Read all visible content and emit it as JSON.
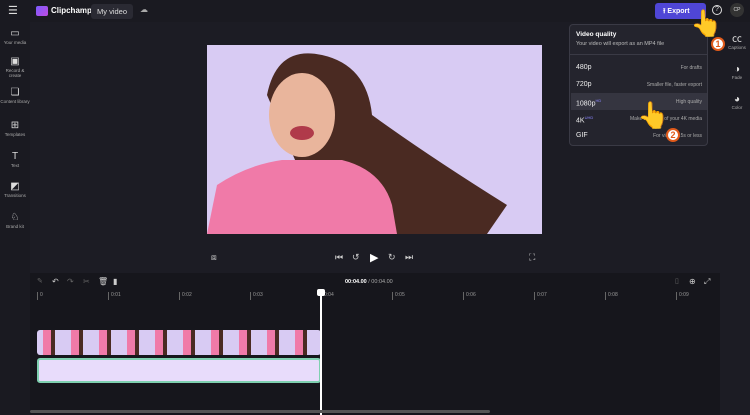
{
  "header": {
    "app_name": "Clipchamp",
    "project_name": "My video",
    "export_label": "Export",
    "avatar": "CP"
  },
  "sidebar": {
    "items": [
      {
        "label": "Your media",
        "icon": "folder-icon"
      },
      {
        "label": "Record & create",
        "icon": "camera-icon"
      },
      {
        "label": "Content library",
        "icon": "library-icon"
      },
      {
        "label": "Templates",
        "icon": "templates-icon"
      },
      {
        "label": "Text",
        "icon": "text-icon"
      },
      {
        "label": "Transitions",
        "icon": "transitions-icon"
      },
      {
        "label": "Brand kit",
        "icon": "brand-kit-icon"
      }
    ]
  },
  "right_panel": {
    "items": [
      {
        "label": "Captions"
      },
      {
        "label": "Fade"
      },
      {
        "label": "Color"
      }
    ]
  },
  "export_menu": {
    "title": "Video quality",
    "subtitle": "Your video will export as an MP4 file",
    "options": [
      {
        "label": "480p",
        "badge": "",
        "desc": "For drafts"
      },
      {
        "label": "720p",
        "badge": "",
        "desc": "Smaller file, faster export"
      },
      {
        "label": "1080p",
        "badge": "HD",
        "desc": "High quality"
      },
      {
        "label": "4K",
        "badge": "UHD",
        "desc": "Make the most of your 4K media"
      },
      {
        "label": "GIF",
        "badge": "",
        "desc": "For videos 15s or less"
      }
    ],
    "selected": "1080p"
  },
  "timeline": {
    "current_time": "00:04.00",
    "total_time": "/ 00:04.00",
    "ticks": [
      "0",
      "0:01",
      "0:02",
      "0:03",
      "0:04",
      "0:05",
      "0:06",
      "0:07",
      "0:08",
      "0:09"
    ]
  },
  "callouts": [
    "1",
    "2"
  ],
  "colors": {
    "accent": "#4f46d6",
    "video_bg": "#d8cbf3",
    "shirt": "#f07aa8"
  }
}
